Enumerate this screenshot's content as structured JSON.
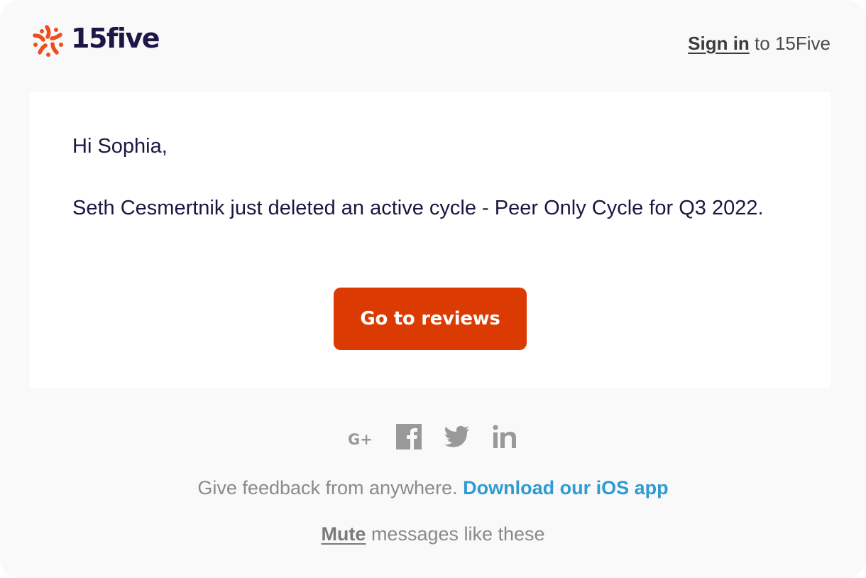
{
  "header": {
    "logo_text": "15five",
    "signin_link": "Sign in",
    "signin_suffix": " to 15Five"
  },
  "email": {
    "greeting": "Hi Sophia,",
    "message": "Seth Cesmertnik just deleted an active cycle - Peer Only Cycle for Q3 2022.",
    "cta_label": "Go to reviews"
  },
  "footer": {
    "social": [
      {
        "name": "google-plus-icon",
        "label": "G+"
      },
      {
        "name": "facebook-icon",
        "label": "f"
      },
      {
        "name": "twitter-icon",
        "label": "twitter"
      },
      {
        "name": "linkedin-icon",
        "label": "in"
      }
    ],
    "feedback_text": "Give feedback from anywhere. ",
    "feedback_link": "Download our iOS app",
    "mute_link": "Mute",
    "mute_suffix": " messages like these"
  },
  "colors": {
    "brand_orange": "#e8461e",
    "brand_navy": "#1e1646",
    "cta": "#db3a02",
    "link_blue": "#2e9bd3",
    "social_gray": "#999999"
  }
}
